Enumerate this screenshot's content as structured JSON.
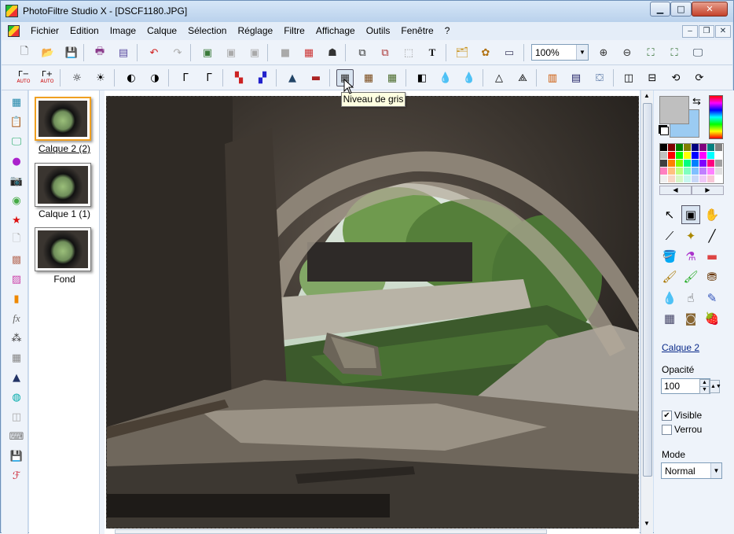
{
  "window": {
    "title": "PhotoFiltre Studio X - [DSCF1180.JPG]",
    "controls": {
      "minimize": "▁",
      "maximize": "□",
      "close": "✕"
    }
  },
  "menu": [
    "Fichier",
    "Edition",
    "Image",
    "Calque",
    "Sélection",
    "Réglage",
    "Filtre",
    "Affichage",
    "Outils",
    "Fenêtre",
    "?"
  ],
  "mdi_controls": {
    "minimize": "–",
    "restore": "❐",
    "close": "✕"
  },
  "toolbar1": {
    "buttons": [
      "new-file",
      "open-folder",
      "save",
      "print",
      "scan",
      "undo",
      "redo",
      "paste-layer",
      "copy-layer",
      "paste-new",
      "grey-square",
      "color-picker",
      "person-mask",
      "image-info",
      "text-info",
      "selection",
      "text-tool",
      "layers-tree",
      "plugins",
      "window-list"
    ],
    "zoom": "100%",
    "zoom_buttons": [
      "zoom-in",
      "zoom-out",
      "fit-window",
      "fit-image",
      "fullscreen"
    ]
  },
  "toolbar2": {
    "gamma_labels": [
      "AUTO",
      "AUTO"
    ],
    "gamma_text": [
      "Γ−",
      "Γ+"
    ],
    "tooltip": "Niveau de gris"
  },
  "layers": [
    {
      "name": "Calque 2 (2)",
      "selected": true
    },
    {
      "name": "Calque 1 (1)",
      "selected": false
    },
    {
      "name": "Fond",
      "selected": false
    }
  ],
  "document": {
    "description": "photo"
  },
  "colors": {
    "foreground": "#bfbfbf",
    "background": "#9bcbf2",
    "palette": [
      "#000000",
      "#800000",
      "#008000",
      "#808000",
      "#000080",
      "#800080",
      "#008080",
      "#808080",
      "#c0c0c0",
      "#ff0000",
      "#00ff00",
      "#ffff00",
      "#0000ff",
      "#ff00ff",
      "#00ffff",
      "#ffffff",
      "#404040",
      "#ff8000",
      "#80ff00",
      "#00ff80",
      "#0080ff",
      "#8000ff",
      "#ff0080",
      "#a0a0a0",
      "#ff80c0",
      "#ffc080",
      "#c0ff80",
      "#80ffc0",
      "#80c0ff",
      "#c080ff",
      "#ff80ff",
      "#e0e0e0",
      "#f0f0f0",
      "#f8d8c8",
      "#d8f8c8",
      "#c8f8f0",
      "#c8d8f8",
      "#f0c8f8",
      "#f8c8d8",
      "#ffffff"
    ],
    "nav_left": "◀",
    "nav_right": "▶"
  },
  "tools": [
    "pointer-tool",
    "selection-tool",
    "hand-tool",
    "eyedropper-tool",
    "magic-wand-tool",
    "line-tool",
    "fill-tool",
    "spray-tool",
    "eraser-tool",
    "brush-tool",
    "advanced-brush-tool",
    "stamp-tool",
    "blur-drop-tool",
    "smudge-tool",
    "retouch-tool",
    "pattern-tool",
    "clone-tool",
    "strawberry-tool"
  ],
  "properties": {
    "layer_name": "Calque 2",
    "opacity_label": "Opacité",
    "opacity_value": "100",
    "visible_label": "Visible",
    "visible_checked": true,
    "lock_label": "Verrou",
    "lock_checked": false,
    "mode_label": "Mode",
    "mode_value": "Normal"
  }
}
